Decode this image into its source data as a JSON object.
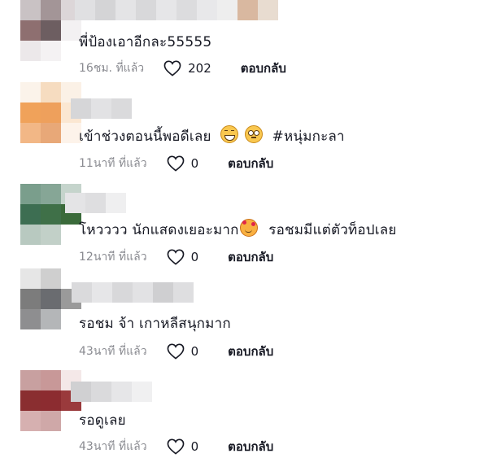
{
  "comments": [
    {
      "text": "พี่ป้องเอาอีกละ55555",
      "time": "16ชม. ที่แล้ว",
      "likes": "202",
      "reply": "ตอบกลับ"
    },
    {
      "text": "เข้าช่วงตอนนี้พอดีเลย",
      "emoji_a": "grinning-squint-emoji",
      "emoji_b": "flushed-emoji",
      "hashtag": "#หนุ่มกะลา",
      "time": "11นาที ที่แล้ว",
      "likes": "0",
      "reply": "ตอบกลับ"
    },
    {
      "text": "โหวววว นักแสดงเยอะมาก",
      "emoji_a": "smiling-hearts-emoji",
      "text_after": "รอชมมีแต่ตัวท็อปเลย",
      "time": "12นาที ที่แล้ว",
      "likes": "0",
      "reply": "ตอบกลับ"
    },
    {
      "text": "รอชม จ้า เกาหลีสนุกมาก",
      "time": "43นาที ที่แล้ว",
      "likes": "0",
      "reply": "ตอบกลับ"
    },
    {
      "text": "รอดูเลย",
      "time": "43นาที ที่แล้ว",
      "likes": "0",
      "reply": "ตอบกลับ"
    }
  ],
  "colors": {
    "text": "#161823",
    "meta": "#8a8b91",
    "heart_stroke": "#161823"
  }
}
